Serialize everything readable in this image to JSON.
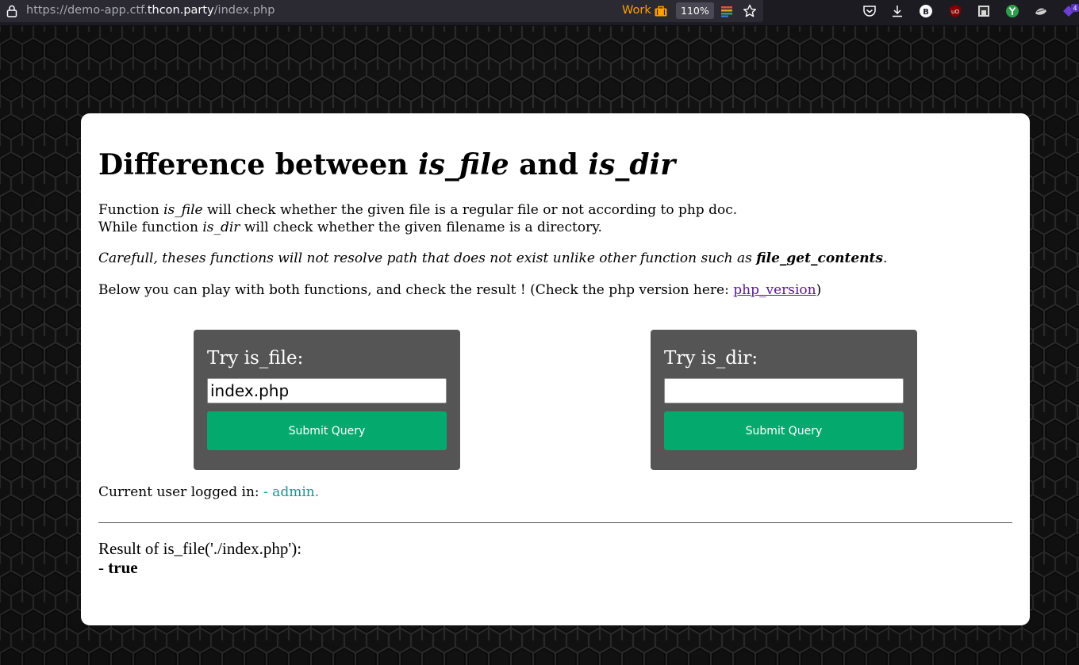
{
  "browser": {
    "url_prefix": "https://demo-app.ctf.",
    "url_host": "thcon.party",
    "url_path": "/index.php",
    "container_label": "Work",
    "zoom_level": "110%",
    "extensions": [
      "pocket-icon",
      "download-icon",
      "bitwarden-icon",
      "ublock-icon",
      "extension-icon",
      "privacy-badger-icon",
      "cookie-icon",
      "extensions-menu-icon"
    ],
    "extensions_badge": "4",
    "colors": {
      "toolbar": "#1c1b22",
      "urlbar": "#2b2a33",
      "container": "#ff9f00"
    }
  },
  "page": {
    "title_prefix": "Difference between ",
    "title_fn1": "is_file",
    "title_mid": " and ",
    "title_fn2": "is_dir",
    "line1_a": "Function ",
    "line1_fn": "is_file",
    "line1_b": " will check whether the given file is a regular file or not according to php doc.",
    "line2_a": "While function ",
    "line2_fn": "is_dir",
    "line2_b": " will check whether the given filename is a directory.",
    "warning_a": "Carefull, theses functions will not resolve path that does not exist unlike other function such as ",
    "warning_fn": "file_get_contents",
    "warning_b": ".",
    "play_a": "Below you can play with both functions, and check the result ! (Check the php version here: ",
    "play_link": "php_version",
    "play_b": ")",
    "is_file_form": {
      "title": "Try is_file:",
      "value": "index.php",
      "button": "Submit Query"
    },
    "is_dir_form": {
      "title": "Try is_dir:",
      "value": "",
      "button": "Submit Query"
    },
    "user_label": "Current user logged in: ",
    "user_value": "- admin.",
    "result_label": "Result of is_file('./index.php'):",
    "result_prefix": "- ",
    "result_value": "true",
    "colors": {
      "panel": "#555555",
      "button": "#04aa6d",
      "user": "#209090",
      "link": "#551a8b"
    }
  }
}
